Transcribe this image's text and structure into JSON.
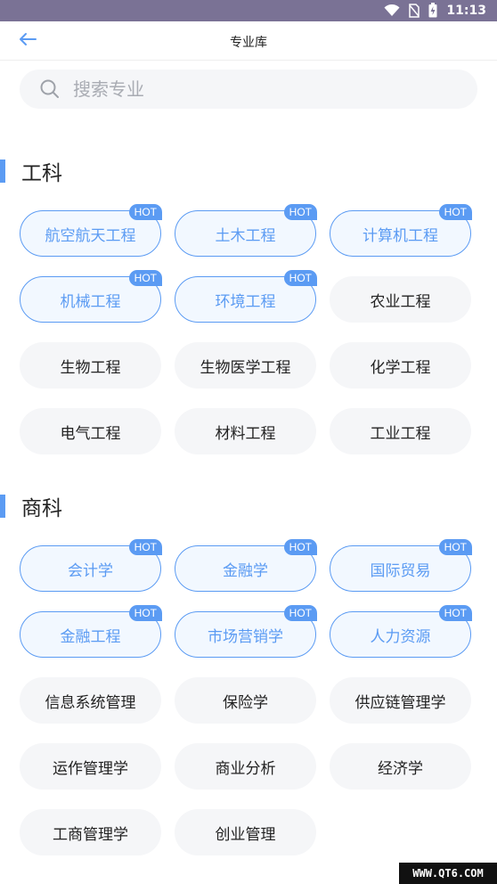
{
  "status": {
    "time": "11:13"
  },
  "header": {
    "title": "专业库"
  },
  "search": {
    "placeholder": "搜索专业",
    "value": ""
  },
  "hot_label": "HOT",
  "sections": [
    {
      "title": "工科",
      "items": [
        {
          "label": "航空航天工程",
          "hot": true
        },
        {
          "label": "土木工程",
          "hot": true
        },
        {
          "label": "计算机工程",
          "hot": true
        },
        {
          "label": "机械工程",
          "hot": true
        },
        {
          "label": "环境工程",
          "hot": true
        },
        {
          "label": "农业工程",
          "hot": false
        },
        {
          "label": "生物工程",
          "hot": false
        },
        {
          "label": "生物医学工程",
          "hot": false
        },
        {
          "label": "化学工程",
          "hot": false
        },
        {
          "label": "电气工程",
          "hot": false
        },
        {
          "label": "材料工程",
          "hot": false
        },
        {
          "label": "工业工程",
          "hot": false
        }
      ]
    },
    {
      "title": "商科",
      "items": [
        {
          "label": "会计学",
          "hot": true
        },
        {
          "label": "金融学",
          "hot": true
        },
        {
          "label": "国际贸易",
          "hot": true
        },
        {
          "label": "金融工程",
          "hot": true
        },
        {
          "label": "市场营销学",
          "hot": true
        },
        {
          "label": "人力资源",
          "hot": true
        },
        {
          "label": "信息系统管理",
          "hot": false
        },
        {
          "label": "保险学",
          "hot": false
        },
        {
          "label": "供应链管理学",
          "hot": false
        },
        {
          "label": "运作管理学",
          "hot": false
        },
        {
          "label": "商业分析",
          "hot": false
        },
        {
          "label": "经济学",
          "hot": false
        },
        {
          "label": "工商管理学",
          "hot": false
        },
        {
          "label": "创业管理",
          "hot": false
        }
      ]
    }
  ],
  "watermark": "WWW.QT6.COM"
}
